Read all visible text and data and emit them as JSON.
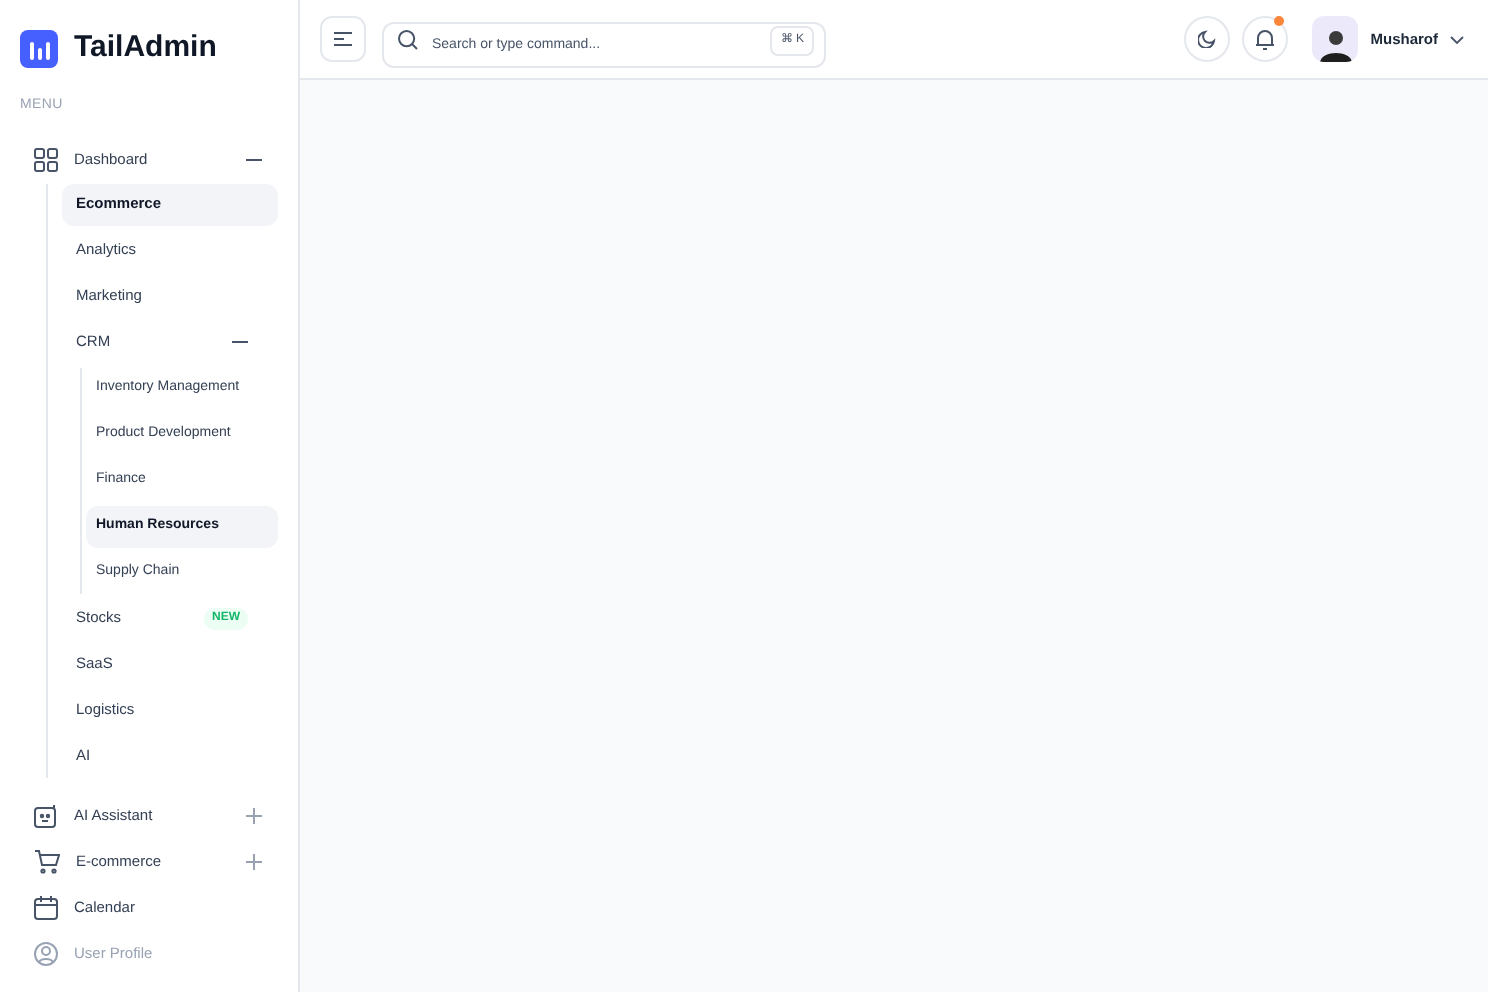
{
  "brand": {
    "name": "TailAdmin"
  },
  "menu_label": "MENU",
  "nav": [
    {
      "label": "Dashboard",
      "expanded": true,
      "children": [
        {
          "label": "Ecommerce",
          "selected": true
        },
        {
          "label": "Analytics",
          "selected": false
        },
        {
          "label": "Marketing",
          "selected": false
        },
        {
          "label": "CRM",
          "selected": false,
          "expanded": true,
          "children": [
            {
              "label": "Inventory Management",
              "selected": false
            },
            {
              "label": "Product Development",
              "selected": false
            },
            {
              "label": "Finance",
              "selected": false
            },
            {
              "label": "Human Resources",
              "selected": true
            },
            {
              "label": "Supply Chain",
              "selected": false
            }
          ]
        },
        {
          "label": "Stocks",
          "selected": false,
          "badge": "NEW"
        },
        {
          "label": "SaaS",
          "selected": false
        },
        {
          "label": "Logistics",
          "selected": false
        },
        {
          "label": "AI",
          "selected": false
        }
      ]
    },
    {
      "label": "AI Assistant",
      "expanded": false
    },
    {
      "label": "E-commerce",
      "expanded": false
    },
    {
      "label": "Calendar"
    },
    {
      "label": "User Profile"
    }
  ],
  "header": {
    "search": {
      "placeholder": "Search or type command...",
      "shortcut": "⌘ K"
    },
    "notifications": {
      "unread": true
    },
    "user": {
      "name": "Musharof"
    }
  }
}
